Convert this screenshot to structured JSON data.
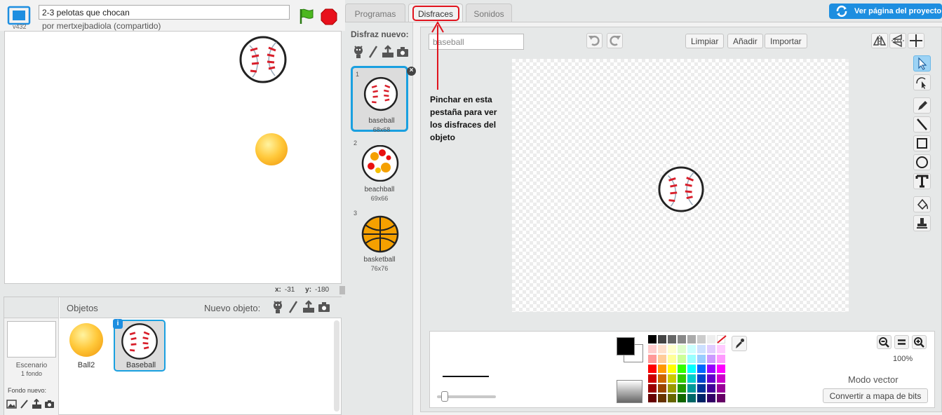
{
  "header": {
    "version": "v432",
    "project_title": "2-3 pelotas que chocan",
    "author": "por mertxejbadiola (compartido)"
  },
  "coords": {
    "x_label": "x:",
    "x_value": "-31",
    "y_label": "y:",
    "y_value": "-180"
  },
  "sprites_panel": {
    "stage_name": "Escenario",
    "stage_backdrops": "1 fondo",
    "new_backdrop_label": "Fondo nuevo:",
    "objects_title": "Objetos",
    "new_object_label": "Nuevo objeto:",
    "sprites": [
      {
        "name": "Ball2"
      },
      {
        "name": "Baseball",
        "selected": true
      }
    ],
    "info_badge": "i"
  },
  "tabs": [
    {
      "label": "Programas"
    },
    {
      "label": "Disfraces",
      "active": true
    },
    {
      "label": "Sonidos"
    }
  ],
  "view_project_page": "Ver página del proyecto",
  "costumes": {
    "new_costume_label": "Disfraz nuevo:",
    "items": [
      {
        "index": "1",
        "name": "baseball",
        "size": "68x68"
      },
      {
        "index": "2",
        "name": "beachball",
        "size": "69x66"
      },
      {
        "index": "3",
        "name": "basketball",
        "size": "76x76"
      }
    ],
    "delete_glyph": "×"
  },
  "editor": {
    "costume_name_value": "baseball",
    "buttons": {
      "clear": "Limpiar",
      "add": "Añadir",
      "import": "Importar"
    },
    "zoom_level": "100%",
    "mode_label": "Modo vector",
    "convert_button": "Convertir a mapa de bits",
    "foreground_color": "#000000",
    "background_color": "#ffffff",
    "palette": [
      "#000000",
      "#444444",
      "#666666",
      "#888888",
      "#aaaaaa",
      "#cccccc",
      "#eeeeee",
      "#ffffff",
      "#ffcccc",
      "#ffe0cc",
      "#ffffcc",
      "#e0ffcc",
      "#ccffff",
      "#cce0ff",
      "#e0ccff",
      "#ffccff",
      "#ff9999",
      "#ffcc99",
      "#ffff99",
      "#ccff99",
      "#99ffff",
      "#99ccff",
      "#cc99ff",
      "#ff99ff",
      "#ff0000",
      "#ff9900",
      "#ffff00",
      "#33ff00",
      "#00ffff",
      "#0066ff",
      "#9900ff",
      "#ff00ff",
      "#cc0000",
      "#cc6600",
      "#cccc00",
      "#33cc00",
      "#00cccc",
      "#0044cc",
      "#6600cc",
      "#cc00cc",
      "#990000",
      "#994400",
      "#999900",
      "#229900",
      "#009999",
      "#003399",
      "#440099",
      "#990099",
      "#660000",
      "#663300",
      "#666600",
      "#116600",
      "#006666",
      "#002266",
      "#330066",
      "#660066"
    ]
  },
  "annotation": {
    "text": "Pinchar en esta pestaña para ver los disfraces del objeto",
    "color": "#e0141e"
  },
  "colors": {
    "accent": "#1d8ee0",
    "selection": "#1aa0e0"
  }
}
